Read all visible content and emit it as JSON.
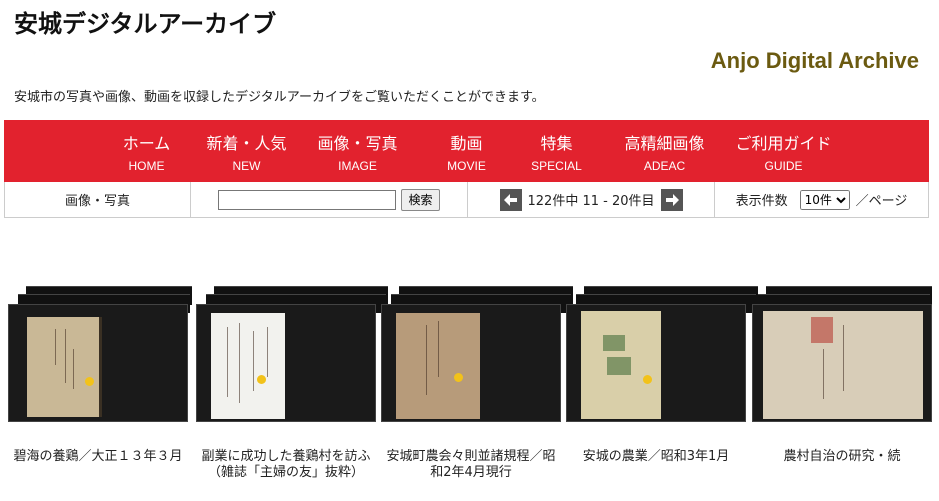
{
  "header": {
    "title": "安城デジタルアーカイブ",
    "title_en": "Anjo Digital Archive",
    "description": "安城市の写真や画像、動画を収録したデジタルアーカイブをご覧いただくことができます。"
  },
  "nav": [
    {
      "jp": "ホーム",
      "en": "HOME"
    },
    {
      "jp": "新着・人気",
      "en": "NEW"
    },
    {
      "jp": "画像・写真",
      "en": "IMAGE"
    },
    {
      "jp": "動画",
      "en": "MOVIE"
    },
    {
      "jp": "特集",
      "en": "SPECIAL"
    },
    {
      "jp": "高精細画像",
      "en": "ADEAC"
    },
    {
      "jp": "ご利用ガイド",
      "en": "GUIDE"
    }
  ],
  "toolbar": {
    "category": "画像・写真",
    "search_value": "",
    "search_button": "検索",
    "pager_text": "122件中 11 - 20件目",
    "count_label": "表示件数",
    "per_page_value": "10件",
    "per_page_suffix": "／ページ"
  },
  "items": [
    {
      "title": "碧海の養鶏／大正１３年３月"
    },
    {
      "title": "副業に成功した養鶏村を訪ふ（雑誌「主婦の友」抜粋）"
    },
    {
      "title": "安城町農会々則並諸規程／昭和2年4月現行"
    },
    {
      "title": "安城の農業／昭和3年1月"
    },
    {
      "title": "農村自治の研究・続"
    }
  ],
  "colors": {
    "nav_bg": "#e2222e",
    "title_en": "#6b5a10"
  }
}
